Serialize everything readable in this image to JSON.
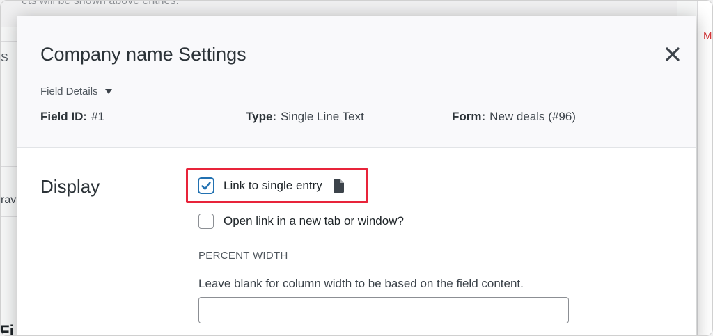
{
  "background": {
    "top_text": "ets will be shown above entries.",
    "left_fragment_1": "S",
    "left_fragment_2": "rav",
    "left_fragment_3": "Fi",
    "right_link": "M"
  },
  "modal": {
    "title": "Company name Settings",
    "close_icon": "close-icon",
    "field_details_label": "Field Details",
    "field_id_label": "Field ID:",
    "field_id_value": "#1",
    "type_label": "Type:",
    "type_value": "Single Line Text",
    "form_label": "Form:",
    "form_value": "New deals (#96)"
  },
  "display": {
    "section_label": "Display",
    "link_to_single_entry": {
      "label": "Link to single entry",
      "checked": true,
      "icon": "document-icon"
    },
    "open_in_new_tab": {
      "label": "Open link in a new tab or window?",
      "checked": false
    },
    "percent_width": {
      "heading": "PERCENT WIDTH",
      "description": "Leave blank for column width to be based on the field content.",
      "value": "",
      "placeholder": ""
    }
  },
  "colors": {
    "highlight": "#e8243a",
    "checkbox_accent": "#2271b1",
    "link_red": "#d63638"
  }
}
